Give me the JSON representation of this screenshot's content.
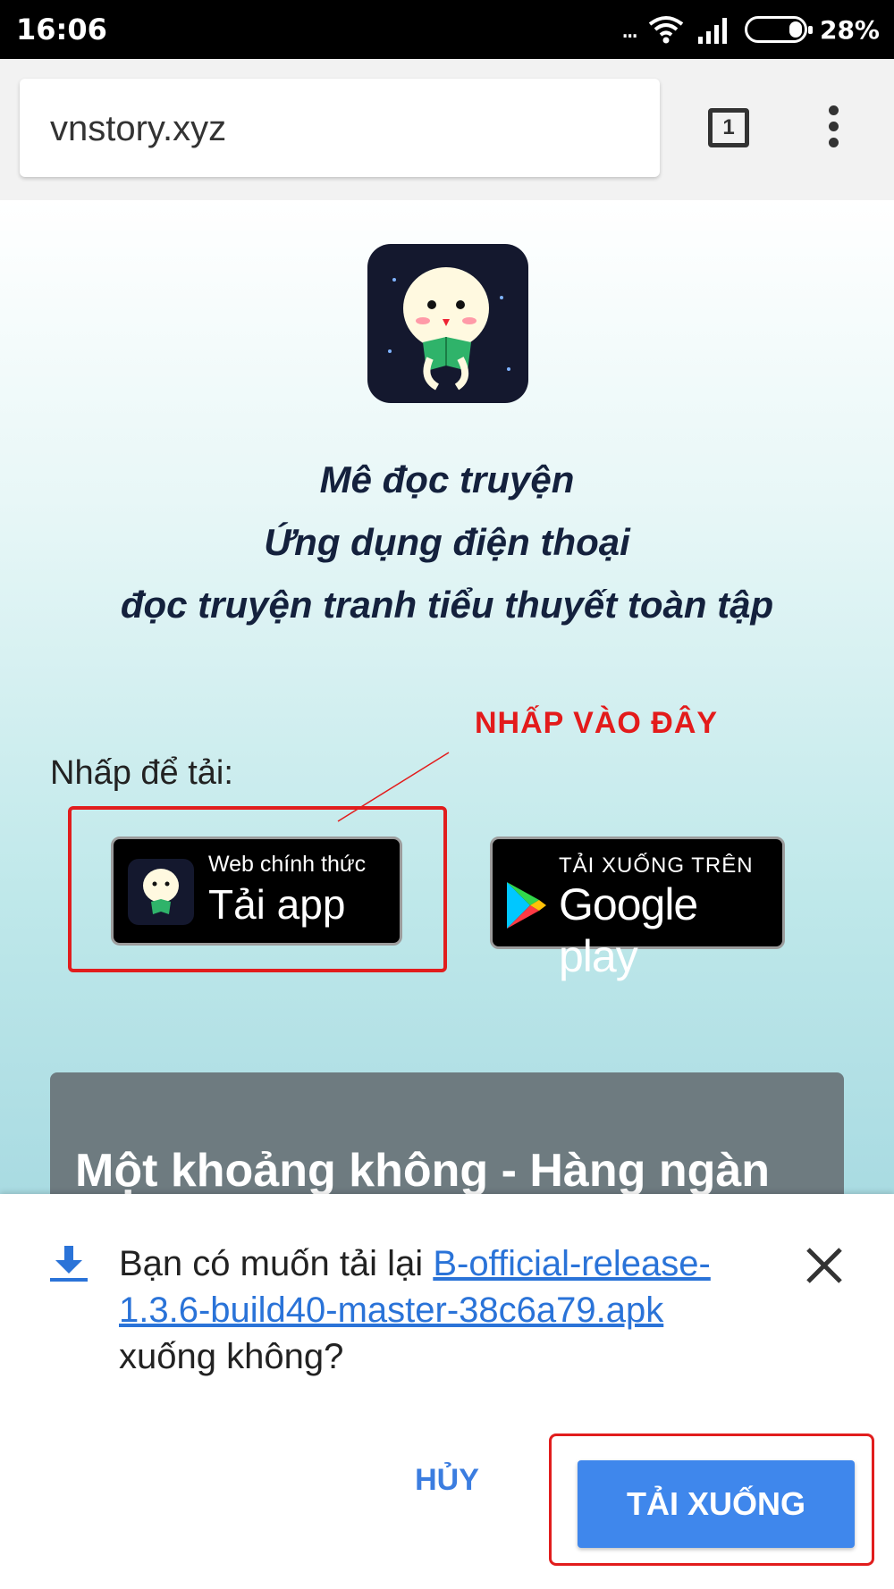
{
  "status_bar": {
    "time": "16:06",
    "more": "...",
    "battery_percent": "28%",
    "battery_level": 0.28
  },
  "browser": {
    "url": "vnstory.xyz",
    "tab_count": "1"
  },
  "page": {
    "heading_lines": [
      "Mê đọc truyện",
      "Ứng dụng điện thoại",
      "đọc truyện tranh tiểu thuyết toàn tập"
    ],
    "annotation": "NHẤP VÀO ĐÂY",
    "download_prompt": "Nhấp để tải:",
    "web_badge": {
      "small": "Web chính thức",
      "big": "Tải app"
    },
    "play_badge": {
      "small": "TẢI XUỐNG TRÊN",
      "big": "Google play"
    },
    "card_title": "Một khoảng không - Hàng ngàn"
  },
  "download_sheet": {
    "message_prefix": "Bạn có muốn tải lại ",
    "file_name": "B-official-release-1.3.6-build40-master-38c6a79.apk",
    "message_suffix": " xuống không?",
    "cancel_label": "HỦY",
    "confirm_label": "TẢI XUỐNG"
  },
  "colors": {
    "link": "#2a73d8",
    "primary_button": "#3f87ec",
    "annotation_red": "#e31b1b"
  }
}
